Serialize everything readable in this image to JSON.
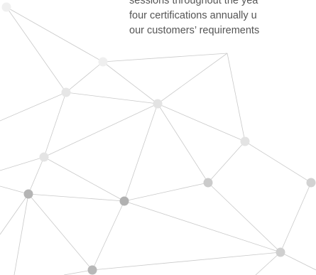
{
  "paragraph": {
    "lines": [
      "sessions throughout the yea",
      "four certifications annually u",
      "our customers’ requirements"
    ]
  },
  "graphic": {
    "line_color": "#c9c9c9",
    "node_colors": [
      "#f0f0f0",
      "#e3e3e3",
      "#cfcfcf",
      "#bdbdbd",
      "#b0b0b0"
    ]
  }
}
